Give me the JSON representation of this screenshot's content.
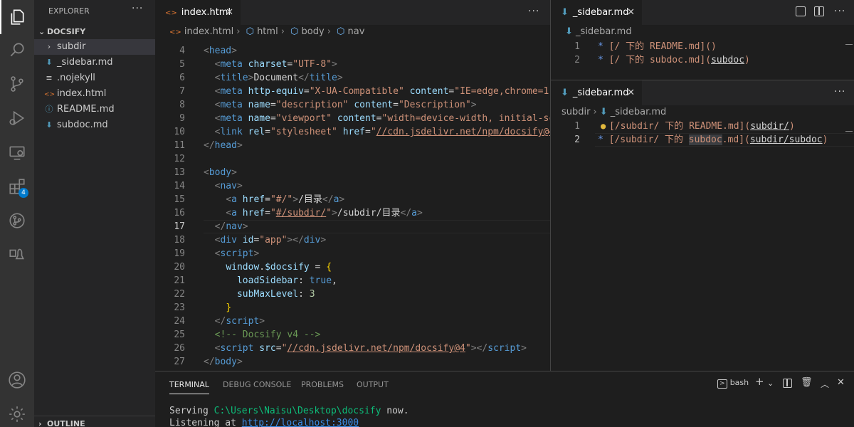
{
  "sidebar": {
    "title": "EXPLORER",
    "more": "···",
    "folder": "DOCSIFY",
    "items": [
      {
        "label": "subdir",
        "icon": "chevron-right-icon",
        "glyph": "›"
      },
      {
        "label": "_sidebar.md",
        "icon": "markdown-icon",
        "glyph": "⬇"
      },
      {
        "label": ".nojekyll",
        "icon": "file-lines-icon",
        "glyph": "≡"
      },
      {
        "label": "index.html",
        "icon": "html-icon",
        "glyph": "<>"
      },
      {
        "label": "README.md",
        "icon": "info-icon",
        "glyph": "ⓘ"
      },
      {
        "label": "subdoc.md",
        "icon": "markdown-icon",
        "glyph": "⬇"
      }
    ],
    "outline": "OUTLINE"
  },
  "left_editor": {
    "tab": "index.html",
    "breadcrumb": [
      "index.html",
      "html",
      "body",
      "nav"
    ],
    "current_line": 17
  },
  "right_top": {
    "tab": "_sidebar.md",
    "breadcrumb": "_sidebar.md",
    "lines": [
      {
        "num": "1",
        "bullet": "*",
        "text": " [/ 下的 README.md]()"
      },
      {
        "num": "2",
        "bullet": "*",
        "text": " [/ 下的 subdoc.md]("
      }
    ],
    "line2_link": "subdoc",
    "line2_end": ")"
  },
  "right_bottom": {
    "tab": "_sidebar.md",
    "breadcrumb": [
      "subdir",
      "_sidebar.md"
    ],
    "line1": {
      "num": "1",
      "a": "[/subdir/ 下的 README.md](",
      "link": "subdir/",
      "b": ")"
    },
    "line2": {
      "num": "2",
      "bullet": "*",
      "a": " [/subdir/ 下的 ",
      "hl": "subdoc",
      "b": ".md](",
      "link": "subdir/subdoc",
      "c": ")"
    }
  },
  "panel": {
    "tabs": [
      "TERMINAL",
      "DEBUG CONSOLE",
      "PROBLEMS",
      "OUTPUT"
    ],
    "shell": "bash",
    "line1_a": "Serving ",
    "line1_path": "C:\\Users\\Naisu\\Desktop\\docsify",
    "line1_b": " now.",
    "line2_a": "Listening at ",
    "line2_url": "http://localhost:3000"
  },
  "activity_badge": "4"
}
